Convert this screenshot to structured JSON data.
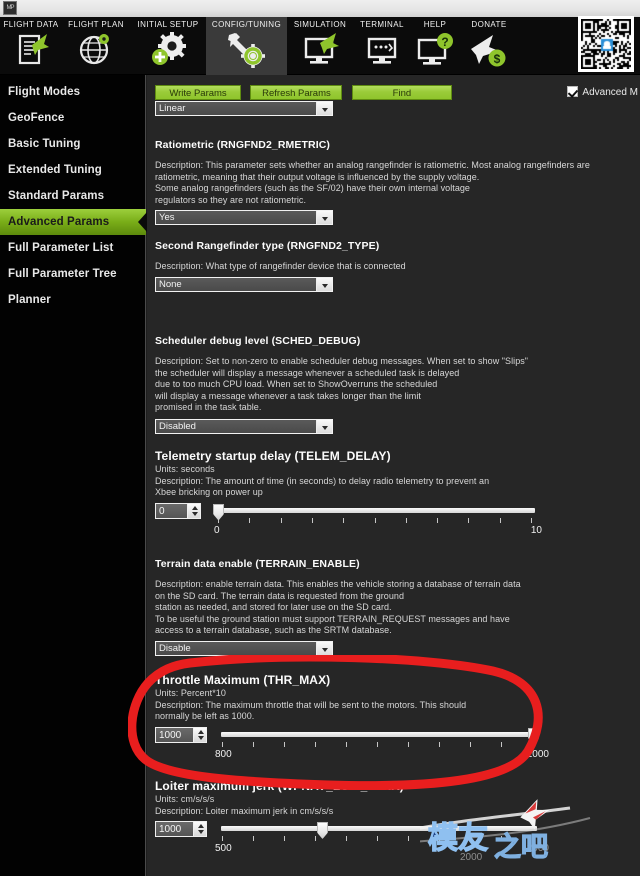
{
  "window": {
    "app_icon": "mission-planner-icon"
  },
  "topnav": {
    "items": [
      {
        "label": "FLIGHT DATA",
        "icon": "document-plane-icon",
        "active": false
      },
      {
        "label": "FLIGHT PLAN",
        "icon": "globe-pin-icon",
        "active": false
      },
      {
        "label": "INITIAL SETUP",
        "icon": "gear-plus-icon",
        "active": false
      },
      {
        "label": "CONFIG/TUNING",
        "icon": "wrench-gear-icon",
        "active": true
      },
      {
        "label": "SIMULATION",
        "icon": "monitor-plane-icon",
        "active": false
      },
      {
        "label": "TERMINAL",
        "icon": "monitor-console-icon",
        "active": false
      },
      {
        "label": "HELP",
        "icon": "monitor-help-icon",
        "active": false
      },
      {
        "label": "DONATE",
        "icon": "plane-dollar-icon",
        "active": false
      }
    ]
  },
  "sidebar": {
    "items": [
      {
        "label": "Flight Modes",
        "selected": false
      },
      {
        "label": "GeoFence",
        "selected": false
      },
      {
        "label": "Basic Tuning",
        "selected": false
      },
      {
        "label": "Extended Tuning",
        "selected": false
      },
      {
        "label": "Standard Params",
        "selected": false
      },
      {
        "label": "Advanced Params",
        "selected": true
      },
      {
        "label": "Full Parameter List",
        "selected": false
      },
      {
        "label": "Full Parameter Tree",
        "selected": false
      },
      {
        "label": "Planner",
        "selected": false
      }
    ]
  },
  "toolbar": {
    "write_params_label": "Write Params",
    "refresh_params_label": "Refresh Params",
    "find_label": "Find",
    "advanced_checkbox_label": "Advanced M",
    "advanced_checked": true
  },
  "params": {
    "partial_top_dropdown": {
      "value": "Linear"
    },
    "ratiometric": {
      "title": "Ratiometric (RNGFND2_RMETRIC)",
      "description": "Description: This parameter sets whether an analog rangefinder is ratiometric. Most analog rangefinders are\nratiometric, meaning that their output voltage is influenced by the supply voltage.\nSome analog rangefinders (such as the SF/02) have their own internal voltage\nregulators so they are not ratiometric.",
      "value": "Yes"
    },
    "second_rangefinder": {
      "title": "Second Rangefinder type (RNGFND2_TYPE)",
      "description": "Description: What type of rangefinder device that is connected",
      "value": "None"
    },
    "sched_debug": {
      "title": "Scheduler debug level (SCHED_DEBUG)",
      "description": "Description: Set to non-zero to enable scheduler debug messages. When set to show \"Slips\"\nthe scheduler will display a message whenever a scheduled task is delayed\ndue to too much CPU load. When set to ShowOverruns the scheduled\nwill display a message whenever a task takes longer than the limit\npromised in the task table.",
      "value": "Disabled"
    },
    "telem_delay": {
      "title": "Telemetry startup delay (TELEM_DELAY)",
      "units": "Units: seconds",
      "description": "Description: The amount of time (in seconds) to delay radio telemetry to prevent an\nXbee bricking on power up",
      "value": "0",
      "min_label": "0",
      "max_label": "10",
      "min": 0,
      "max": 10,
      "ticks": 11
    },
    "terrain_enable": {
      "title": "Terrain data enable (TERRAIN_ENABLE)",
      "description": "Description: enable terrain data. This enables the vehicle storing a database of terrain data\non the SD card. The terrain data is requested from the ground\nstation as needed, and stored for later use on the SD card.\nTo be useful the ground station must support  TERRAIN_REQUEST messages and have\naccess to a terrain database, such as the SRTM database.",
      "value": "Disable"
    },
    "thr_max": {
      "title": "Throttle Maximum (THR_MAX)",
      "units": "Units: Percent*10",
      "description": "Description: The maximum throttle that will be sent to the motors.   This should\nnormally be left as 1000.",
      "value": "1000",
      "min_label": "800",
      "max_label": "1000",
      "min": 800,
      "max": 1000,
      "ticks": 11,
      "highlighted": true
    },
    "wpnav_loit_jerk": {
      "title": "Loiter maximum jerk (WPNAV_LOIT_JERK)",
      "units": "Units: cm/s/s/s",
      "description": "Description:  Loiter maximum jerk in cm/s/s/s",
      "value": "1000",
      "min_label": "500",
      "max_label": "2000",
      "min": 500,
      "max": 2000,
      "ticks": 11
    }
  },
  "annotation": {
    "shape": "red-ellipse-highlight",
    "color": "#e81e1e",
    "target": "Throttle Maximum (THR_MAX)"
  },
  "watermark": {
    "text": "模友之吧",
    "sub": "2000",
    "logo": "airplane-icon",
    "qr": "qr-code"
  }
}
